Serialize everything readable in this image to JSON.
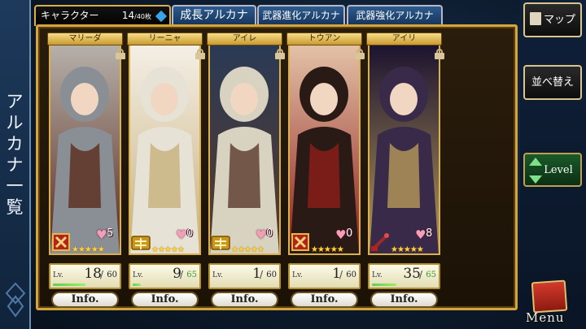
{
  "side_title": "アルカナ一覧",
  "tabs": {
    "characters": {
      "label": "キャラクター",
      "count": "14",
      "count_total": "/40枚"
    },
    "growth": "成長アルカナ",
    "weapon_evolve": "武器進化アルカナ",
    "weapon_enhance": "武器強化アルカナ"
  },
  "buttons": {
    "map": "マップ",
    "sort": "並べ替え",
    "level": "Level",
    "menu": "Menu"
  },
  "cards": [
    {
      "name": "マリーダ",
      "stars": "★★★★★",
      "hearts": "5",
      "level": "18",
      "max": "60",
      "max_green": false,
      "exp_fraction": 0.5,
      "info": "Info.",
      "icon": "cross-weapon-icon",
      "palette": [
        "#8a8f96",
        "#5a2a1c",
        "#b6b0aa"
      ]
    },
    {
      "name": "リーニャ",
      "stars": "★★★★★",
      "hearts": "0",
      "level": "9",
      "max": "65",
      "max_green": true,
      "exp_fraction": 0.12,
      "info": "Info.",
      "icon": "gold-emblem-icon",
      "palette": [
        "#e7e2d6",
        "#c7b07a",
        "#f4efe6"
      ]
    },
    {
      "name": "アイレ",
      "stars": "★★★★★",
      "hearts": "0",
      "level": "1",
      "max": "60",
      "max_green": false,
      "exp_fraction": 0.0,
      "info": "Info.",
      "icon": "gold-emblem-icon",
      "palette": [
        "#d8d2c0",
        "#5a3a2a",
        "#2a3a55"
      ]
    },
    {
      "name": "トウアン",
      "stars": "★★★★★",
      "hearts": "0",
      "level": "1",
      "max": "60",
      "max_green": false,
      "exp_fraction": 0.0,
      "info": "Info.",
      "icon": "cross-weapon-icon",
      "palette": [
        "#2a1a16",
        "#8e1e1a",
        "#e3c1a7"
      ]
    },
    {
      "name": "アイリ",
      "stars": "★★★★★",
      "hearts": "8",
      "level": "35",
      "max": "65",
      "max_green": true,
      "exp_fraction": 0.38,
      "info": "Info.",
      "icon": "staff-weapon-icon",
      "palette": [
        "#3a2a4a",
        "#b89a5a",
        "#1c1430"
      ]
    }
  ]
}
